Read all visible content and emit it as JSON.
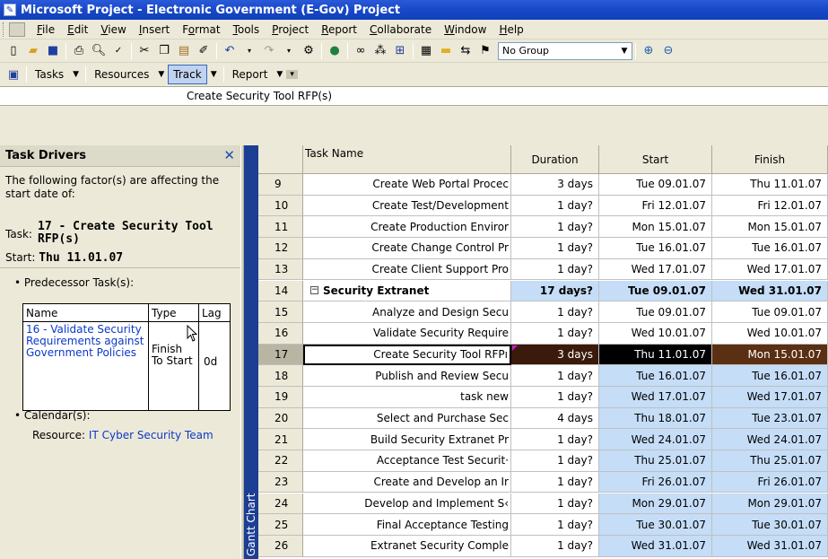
{
  "window": {
    "title": "Microsoft Project - Electronic Government (E-Gov) Project"
  },
  "menu": [
    "File",
    "Edit",
    "View",
    "Insert",
    "Format",
    "Tools",
    "Project",
    "Report",
    "Collaborate",
    "Window",
    "Help"
  ],
  "toolbar": {
    "group_value": "No Group"
  },
  "guide": {
    "tasks": "Tasks",
    "resources": "Resources",
    "track": "Track",
    "report": "Report"
  },
  "entry_bar": {
    "value": "Create Security Tool RFP(s)"
  },
  "task_drivers": {
    "title": "Task Drivers",
    "factor_text": "The following factor(s) are affecting the start date of:",
    "task_label": "Task:",
    "task_value": "17 - Create Security Tool RFP(s)",
    "start_label": "Start:",
    "start_value": "Thu 11.01.07",
    "predecessor_heading": "Predecessor Task(s):",
    "pred_columns": [
      "Name",
      "Type",
      "Lag"
    ],
    "pred_row": {
      "name": "16 - Validate Security Requirements against Government Policies",
      "type": "Finish To Start",
      "lag": "0d"
    },
    "calendar_heading": "Calendar(s):",
    "resource_label": "Resource:",
    "resource_value": "IT Cyber Security Team"
  },
  "view_bar": {
    "label": "Gantt Chart"
  },
  "grid": {
    "columns": [
      "Task Name",
      "Duration",
      "Start",
      "Finish"
    ],
    "rows": [
      {
        "id": "9",
        "name": "Create Web Portal Procec",
        "duration": "3 days",
        "start": "Tue 09.01.07",
        "finish": "Thu 11.01.07"
      },
      {
        "id": "10",
        "name": "Create Test/Development",
        "duration": "1 day?",
        "start": "Fri 12.01.07",
        "finish": "Fri 12.01.07"
      },
      {
        "id": "11",
        "name": "Create Production Enviror",
        "duration": "1 day?",
        "start": "Mon 15.01.07",
        "finish": "Mon 15.01.07"
      },
      {
        "id": "12",
        "name": "Create Change Control Pr",
        "duration": "1 day?",
        "start": "Tue 16.01.07",
        "finish": "Tue 16.01.07"
      },
      {
        "id": "13",
        "name": "Create Client Support Pro",
        "duration": "1 day?",
        "start": "Wed 17.01.07",
        "finish": "Wed 17.01.07"
      },
      {
        "id": "14",
        "name": "Security Extranet",
        "duration": "17 days?",
        "start": "Tue 09.01.07",
        "finish": "Wed 31.01.07"
      },
      {
        "id": "15",
        "name": "Analyze and Design Secu",
        "duration": "1 day?",
        "start": "Tue 09.01.07",
        "finish": "Tue 09.01.07"
      },
      {
        "id": "16",
        "name": "Validate Security Require",
        "duration": "1 day?",
        "start": "Wed 10.01.07",
        "finish": "Wed 10.01.07"
      },
      {
        "id": "17",
        "name": "Create Security Tool RFPı",
        "duration": "3 days",
        "start": "Thu 11.01.07",
        "finish": "Mon 15.01.07"
      },
      {
        "id": "18",
        "name": "Publish and Review Secu",
        "duration": "1 day?",
        "start": "Tue 16.01.07",
        "finish": "Tue 16.01.07"
      },
      {
        "id": "19",
        "name": "task new",
        "duration": "1 day?",
        "start": "Wed 17.01.07",
        "finish": "Wed 17.01.07"
      },
      {
        "id": "20",
        "name": "Select and Purchase Sec",
        "duration": "4 days",
        "start": "Thu 18.01.07",
        "finish": "Tue 23.01.07"
      },
      {
        "id": "21",
        "name": "Build Security Extranet Pr",
        "duration": "1 day?",
        "start": "Wed 24.01.07",
        "finish": "Wed 24.01.07"
      },
      {
        "id": "22",
        "name": "Acceptance Test Securit·",
        "duration": "1 day?",
        "start": "Thu 25.01.07",
        "finish": "Thu 25.01.07"
      },
      {
        "id": "23",
        "name": "Create and Develop an Ir",
        "duration": "1 day?",
        "start": "Fri 26.01.07",
        "finish": "Fri 26.01.07"
      },
      {
        "id": "24",
        "name": "Develop and Implement S‹",
        "duration": "1 day?",
        "start": "Mon 29.01.07",
        "finish": "Mon 29.01.07"
      },
      {
        "id": "25",
        "name": "Final Acceptance Testing",
        "duration": "1 day?",
        "start": "Tue 30.01.07",
        "finish": "Tue 30.01.07"
      },
      {
        "id": "26",
        "name": "Extranet Security Comple",
        "duration": "1 day?",
        "start": "Wed 31.01.07",
        "finish": "Wed 31.01.07"
      }
    ]
  }
}
